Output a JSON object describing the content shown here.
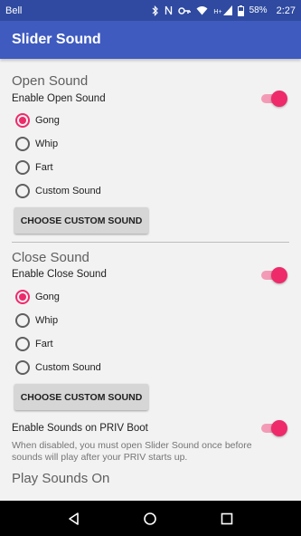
{
  "status_bar": {
    "carrier": "Bell",
    "battery": "58%",
    "time": "2:27",
    "icons": [
      "bluetooth-icon",
      "nfc-icon",
      "key-icon",
      "wifi-icon",
      "hplus-signal-icon",
      "battery-icon"
    ],
    "signal_text": "H+"
  },
  "app_bar": {
    "title": "Slider Sound"
  },
  "open_section": {
    "title": "Open Sound",
    "enable_label": "Enable Open Sound",
    "enabled": true,
    "options": [
      {
        "label": "Gong",
        "checked": true
      },
      {
        "label": "Whip",
        "checked": false
      },
      {
        "label": "Fart",
        "checked": false
      },
      {
        "label": "Custom Sound",
        "checked": false
      }
    ],
    "button": "CHOOSE CUSTOM SOUND"
  },
  "close_section": {
    "title": "Close Sound",
    "enable_label": "Enable Close Sound",
    "enabled": true,
    "options": [
      {
        "label": "Gong",
        "checked": true
      },
      {
        "label": "Whip",
        "checked": false
      },
      {
        "label": "Fart",
        "checked": false
      },
      {
        "label": "Custom Sound",
        "checked": false
      }
    ],
    "button": "CHOOSE CUSTOM SOUND"
  },
  "boot": {
    "label": "Enable Sounds on PRIV Boot",
    "summary": "When disabled, you must open Slider Sound once before sounds will play after your PRIV starts up.",
    "enabled": true
  },
  "play_on": {
    "title": "Play Sounds On"
  },
  "colors": {
    "accent": "#ee2a6b",
    "primary": "#3f5bc0",
    "primary_dark": "#2f4aa0"
  }
}
